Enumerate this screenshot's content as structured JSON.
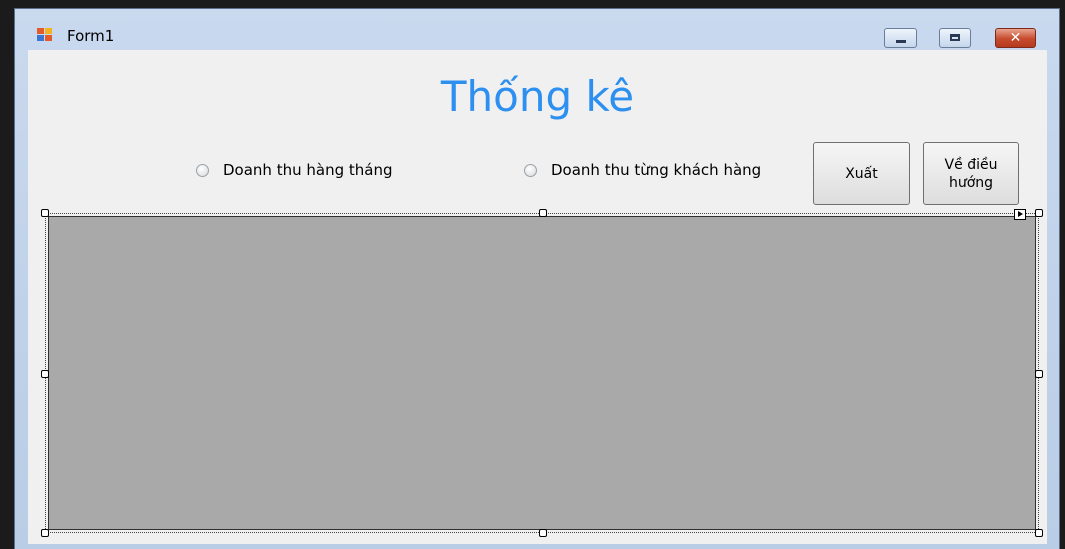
{
  "window": {
    "title": "Form1",
    "controls": {
      "minimize": "minimize",
      "maximize": "maximize",
      "close": "✕"
    }
  },
  "form": {
    "heading": "Thống kê",
    "options": [
      {
        "label": "Doanh thu hàng tháng",
        "checked": false
      },
      {
        "label": "Doanh thu từng khách hàng",
        "checked": false
      }
    ],
    "buttons": {
      "export": "Xuất",
      "back": "Về điều hướng"
    }
  },
  "colors": {
    "heading": "#2d8ff0",
    "chart_area": "#a9a9a9",
    "client": "#f0f0f0"
  }
}
